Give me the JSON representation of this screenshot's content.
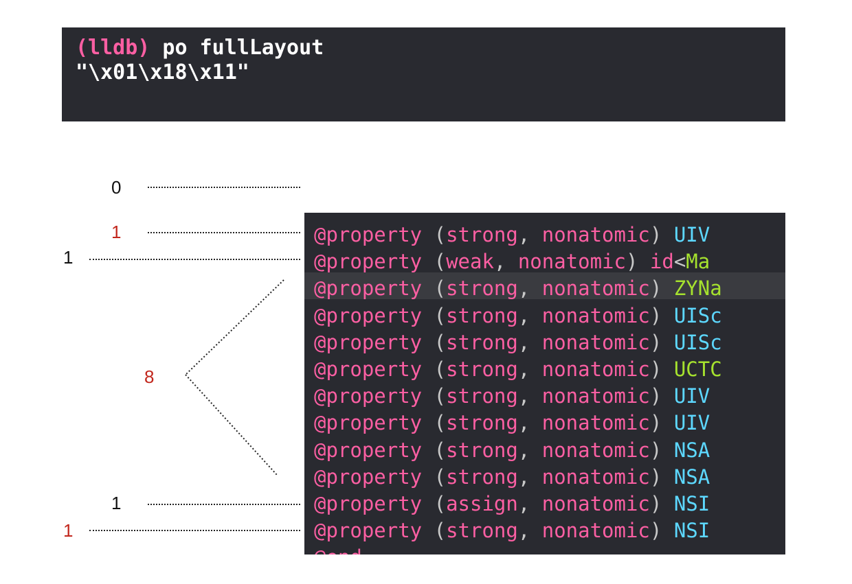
{
  "console": {
    "prompt": "(lldb)",
    "command": " po fullLayout",
    "output": "\"\\x01\\x18\\x11\""
  },
  "annotations": {
    "n0": "0",
    "n1a": "1",
    "n1b": "1",
    "n8": "8",
    "n1c": "1",
    "n1d": "1"
  },
  "code": {
    "kw": "@property",
    "rows": [
      {
        "attrs": " (strong, nonatomic) ",
        "type": "UIV",
        "type_color": "blue"
      },
      {
        "attrs": " (weak, nonatomic) ",
        "type": "id<Ma",
        "type_color": "mixed"
      },
      {
        "attrs": " (strong, nonatomic) ",
        "type": "ZYNa",
        "type_color": "green"
      },
      {
        "attrs": " (strong, nonatomic) ",
        "type": "UISc",
        "type_color": "blue"
      },
      {
        "attrs": " (strong, nonatomic) ",
        "type": "UISc",
        "type_color": "blue"
      },
      {
        "attrs": " (strong, nonatomic) ",
        "type": "UCTC",
        "type_color": "green"
      },
      {
        "attrs": " (strong, nonatomic) ",
        "type": "UIV",
        "type_color": "blue"
      },
      {
        "attrs": " (strong, nonatomic) ",
        "type": "UIV",
        "type_color": "blue"
      },
      {
        "attrs": " (strong, nonatomic) ",
        "type": "NSA",
        "type_color": "blue"
      },
      {
        "attrs": " (strong, nonatomic) ",
        "type": "NSA",
        "type_color": "blue"
      },
      {
        "attrs": " (assign, nonatomic) ",
        "type": "NSI",
        "type_color": "blue"
      },
      {
        "attrs": " (strong, nonatomic) ",
        "type": "NSI",
        "type_color": "blue"
      }
    ],
    "end": "@end"
  },
  "colors": {
    "bg": "#292a30",
    "keyword": "#fc5fa3",
    "type": "#5dd8ff",
    "type_project": "#a6e22e",
    "annotation_red": "#c2271d"
  }
}
